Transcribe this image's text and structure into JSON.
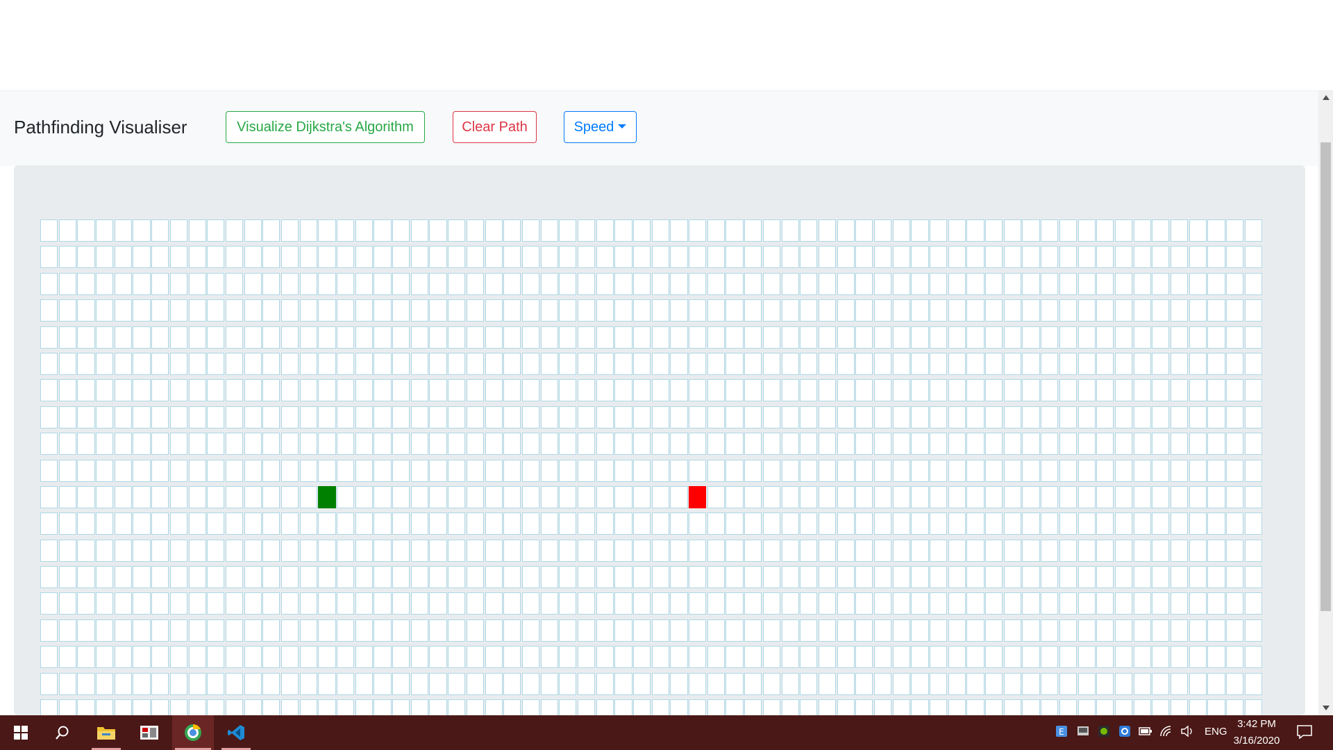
{
  "navbar": {
    "brand": "Pathfinding Visualiser",
    "visualize_label": "Visualize Dijkstra's Algorithm",
    "clear_label": "Clear Path",
    "speed_label": "Speed"
  },
  "grid": {
    "visible_rows": 19,
    "columns": 66,
    "start_node": {
      "row": 10,
      "col": 15
    },
    "end_node": {
      "row": 10,
      "col": 35
    },
    "colors": {
      "cell_border": "#add8e6",
      "start": "#008000",
      "end": "#ff0000",
      "background": "#e9ecef"
    }
  },
  "button_colors": {
    "visualize": "#28a745",
    "clear": "#dc3545",
    "speed": "#007bff"
  },
  "taskbar": {
    "apps": [
      "windows-start-icon",
      "search-icon",
      "file-explorer-icon",
      "app-icon",
      "chrome-icon",
      "vscode-icon"
    ],
    "language": "ENG",
    "time": "3:42 PM",
    "date": "3/16/2020"
  }
}
